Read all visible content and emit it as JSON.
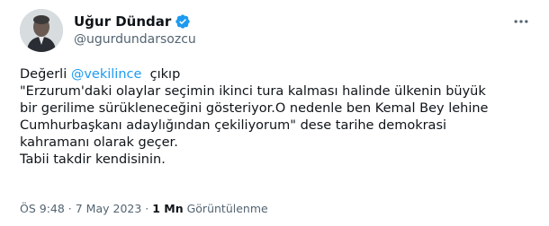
{
  "author": {
    "display_name": "Uğur Dündar",
    "handle": "@ugurdundarsozcu",
    "verified_icon": "verified-badge-icon",
    "avatar_icon": "profile-photo"
  },
  "menu": {
    "icon": "more-horizontal-icon"
  },
  "tweet": {
    "line1_prefix": "Değerli ",
    "mention": "@vekilince",
    "line1_suffix": "  çıkıp",
    "line2": "\"Erzurum'daki olaylar seçimin ikinci tura kalması halinde ülkenin büyük",
    "line3": "bir gerilime sürükleneceğini gösteriyor.O nedenle ben Kemal Bey lehine",
    "line4": "Cumhurbaşkanı adaylığından çekiliyorum\" dese tarihe demokrasi",
    "line5": "kahramanı olarak geçer.",
    "line6": "Tabii takdir kendisinin."
  },
  "meta": {
    "time": "ÖS 9:48",
    "separator1": " · ",
    "date": "7 May 2023",
    "separator2": " · ",
    "views_count": "1 Mn",
    "views_label": " Görüntülenme"
  },
  "colors": {
    "accent": "#1d9bf0",
    "text": "#0f1419",
    "secondary": "#536471"
  }
}
